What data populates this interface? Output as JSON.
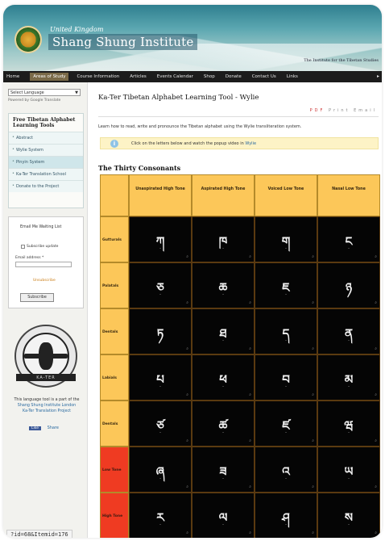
{
  "header": {
    "brand_small": "United Kingdom",
    "brand_name": "Shang Shung Institute",
    "tagline": "The Institute for the Tibetan Studies"
  },
  "nav": {
    "items": [
      "Home",
      "Areas of Study",
      "Course Information",
      "Articles",
      "Events Calendar",
      "Shop",
      "Donate",
      "Contact Us",
      "Links"
    ],
    "active_index": 1
  },
  "sidebar": {
    "language_select": "Select Language",
    "powered_by": "Powered by Google Translate",
    "menu_title": "Free Tibetan Alphabet Learning Tools",
    "menu_items": [
      "Abstract",
      "Wylie System",
      "Pinyin System",
      "Ka-Ter Translation School",
      "Donate to the Project"
    ],
    "selected_index": 2,
    "login": {
      "remember_label": "Email Me Waiting List",
      "remember_text": "Subscribe update",
      "email_label": "Email address *",
      "forgot": "Unsubscribe",
      "button": "Subscribe"
    },
    "seal_text": "KA-TER",
    "credit_text": "This language tool is a part of the",
    "credit_link1": "Shang Shung Institute London",
    "credit_link2": "Ka-Ter Translation Project",
    "share_like": "Like",
    "share_text": "Share"
  },
  "main": {
    "title": "Ka-Ter Tibetan Alphabet Learning Tool - Wylie",
    "tools": [
      "PDF",
      "Print",
      "Email"
    ],
    "intro": "Learn how to read, write and pronounce the Tibetan alphabet using the Wylie transliteration system.",
    "info_text": "Click on the letters below and watch the popup video in",
    "info_link": "Wylie",
    "section_heading": "The Thirty Consonants"
  },
  "table": {
    "columns": [
      "Unaspirated High Tone",
      "Aspirated High Tone",
      "Voiced Low Tone",
      "Nasal Low Tone"
    ],
    "rows": [
      {
        "label": "Gutturals",
        "color": "#fcc759",
        "letters": [
          "ཀ",
          "ཁ",
          "ག",
          "ང"
        ]
      },
      {
        "label": "Palatals",
        "color": "#fcc759",
        "letters": [
          "ཅ",
          "ཆ",
          "ཇ",
          "ཉ"
        ]
      },
      {
        "label": "Dentals",
        "color": "#fcc759",
        "letters": [
          "ཏ",
          "ཐ",
          "ད",
          "ན"
        ]
      },
      {
        "label": "Labials",
        "color": "#fcc759",
        "letters": [
          "པ",
          "ཕ",
          "བ",
          "མ"
        ]
      },
      {
        "label": "Dentals",
        "color": "#fcc759",
        "letters": [
          "ཙ",
          "ཚ",
          "ཛ",
          "ཝ"
        ]
      },
      {
        "label": "Low Tone",
        "color": "#ef3b22",
        "letters": [
          "ཞ",
          "ཟ",
          "འ",
          "ཡ"
        ]
      },
      {
        "label": "High Tone",
        "color": "#ef3b22",
        "letters": [
          "ར",
          "ལ",
          "ཤ",
          "ས"
        ]
      }
    ],
    "mark": "-"
  },
  "status_bar": "?id=68&Itemid=176",
  "colors": {
    "header_orange": "#fcc759",
    "row_red": "#ef3b22",
    "nav_bg": "#1c1c1c",
    "cell_bg": "#050505"
  }
}
